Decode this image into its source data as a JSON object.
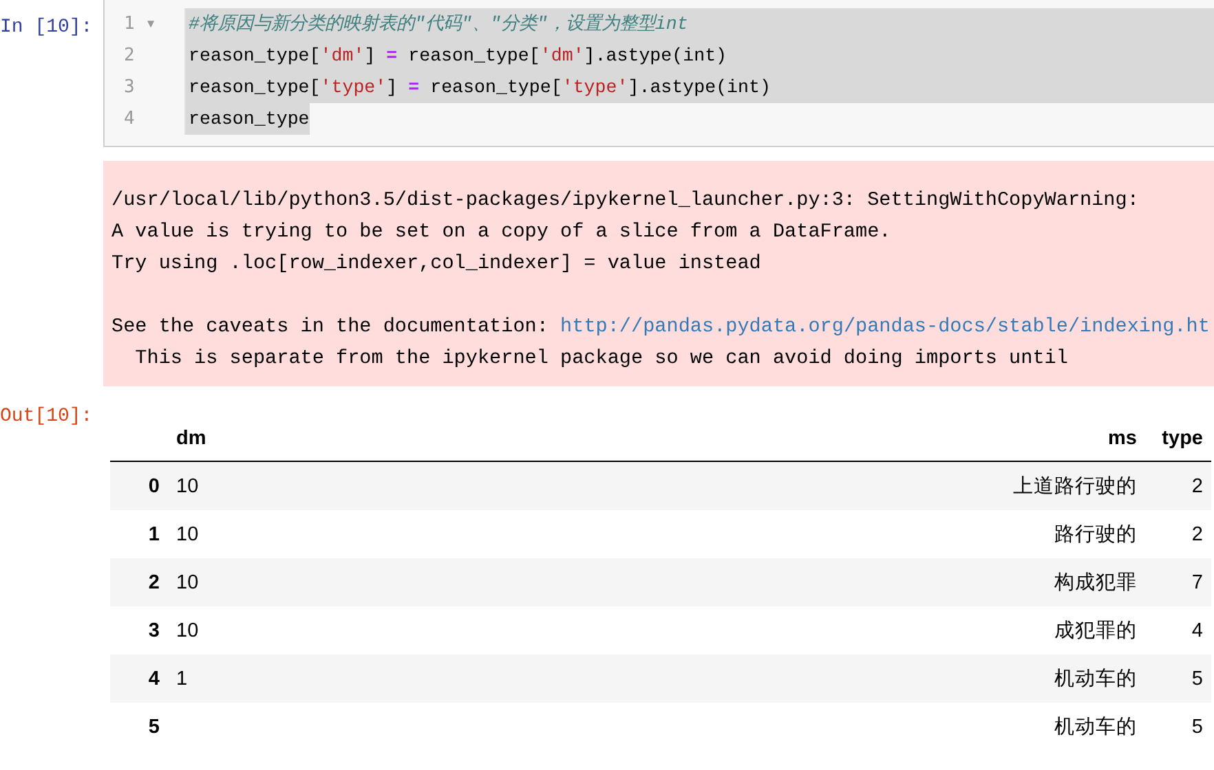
{
  "input_cell": {
    "prompt": "In [10]:",
    "lines": [
      {
        "number": "1",
        "fold": "▾",
        "selected_to_edge": true,
        "tokens": [
          {
            "kind": "comment",
            "text": "#将原因与新分类的映射表的\"代码\"、\"分类\"，设置为整型int"
          }
        ]
      },
      {
        "number": "2",
        "selected_to_edge": true,
        "tokens": [
          {
            "kind": "text",
            "text": "reason_type["
          },
          {
            "kind": "string",
            "text": "'dm'"
          },
          {
            "kind": "text",
            "text": "] "
          },
          {
            "kind": "op",
            "text": "="
          },
          {
            "kind": "text",
            "text": " reason_type["
          },
          {
            "kind": "string",
            "text": "'dm'"
          },
          {
            "kind": "text",
            "text": "].astype(int)"
          }
        ]
      },
      {
        "number": "3",
        "selected_to_edge": true,
        "tokens": [
          {
            "kind": "text",
            "text": "reason_type["
          },
          {
            "kind": "string",
            "text": "'type'"
          },
          {
            "kind": "text",
            "text": "] "
          },
          {
            "kind": "op",
            "text": "="
          },
          {
            "kind": "text",
            "text": " reason_type["
          },
          {
            "kind": "string",
            "text": "'type'"
          },
          {
            "kind": "text",
            "text": "].astype(int)"
          }
        ]
      },
      {
        "number": "4",
        "selected_to_edge": false,
        "tokens": [
          {
            "kind": "text",
            "text": "reason_type"
          }
        ]
      }
    ]
  },
  "stderr": {
    "paragraphs": [
      {
        "lines": [
          {
            "parts": [
              {
                "kind": "text",
                "text": "/usr/local/lib/python3.5/dist-packages/ipykernel_launcher.py:3: SettingWithCopyWarning:"
              }
            ]
          },
          {
            "parts": [
              {
                "kind": "text",
                "text": "A value is trying to be set on a copy of a slice from a DataFrame."
              }
            ]
          },
          {
            "parts": [
              {
                "kind": "text",
                "text": "Try using .loc[row_indexer,col_indexer] = value instead"
              }
            ]
          }
        ]
      },
      {
        "lines": [
          {
            "parts": [
              {
                "kind": "text",
                "text": "See the caveats in the documentation: "
              },
              {
                "kind": "link",
                "text": "http://pandas.pydata.org/pandas-docs/stable/indexing.ht"
              }
            ]
          },
          {
            "parts": [
              {
                "kind": "text",
                "text": "  This is separate from the ipykernel package so we can avoid doing imports until"
              }
            ]
          }
        ]
      }
    ]
  },
  "output_cell": {
    "prompt": "Out[10]:",
    "table": {
      "columns": [
        "dm",
        "ms",
        "type"
      ],
      "rows": [
        {
          "index": "0",
          "dm": "10",
          "ms": "上道路行驶的",
          "type": "2"
        },
        {
          "index": "1",
          "dm": "10",
          "ms": "路行驶的",
          "type": "2"
        },
        {
          "index": "2",
          "dm": "10",
          "ms": "构成犯罪",
          "type": "7"
        },
        {
          "index": "3",
          "dm": "10",
          "ms": "成犯罪的",
          "type": "4"
        },
        {
          "index": "4",
          "dm": "1",
          "ms": "机动车的",
          "type": "5"
        },
        {
          "index": "5",
          "ms": "机动车的",
          "type": "5"
        }
      ]
    }
  }
}
